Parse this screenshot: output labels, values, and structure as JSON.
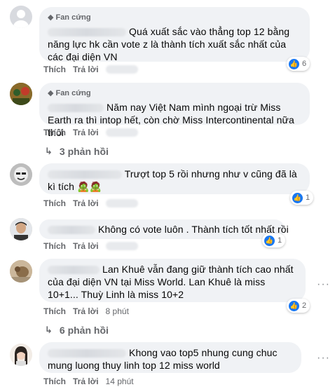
{
  "comments": [
    {
      "badge": "Fan cứng",
      "text": "Quá xuất sắc vào thẳng top 12 bằng năng lực hk cần vote z là thành tích xuất sắc nhất của các đại diện VN",
      "like": "Thích",
      "reply": "Trả lời",
      "reactions": "6"
    },
    {
      "badge": "Fan cứng",
      "text": "Năm nay Việt Nam mình ngoại trừ Miss Earth ra thì intop hết, còn chờ Miss Intercontinental nữa thôi",
      "like": "Thích",
      "reply": "Trả lời",
      "replies": "3 phản hồi"
    },
    {
      "text": "Trượt top 5 rồi nhưng như v cũng đã là kì tích 🧟🧟",
      "like": "Thích",
      "reply": "Trả lời",
      "reactions": "1"
    },
    {
      "text": "Không có vote luôn . Thành tích tốt nhất rồi",
      "like": "Thích",
      "reply": "Trả lời",
      "reactions": "1"
    },
    {
      "text": "Lan Khuê vẫn đang giữ thành tích cao nhất của đại diện VN tại Miss World. Lan Khuê là miss 10+1... Thuỳ Linh là miss 10+2",
      "like": "Thích",
      "reply": "Trả lời",
      "time": "8 phút",
      "reactions": "2",
      "replies": "6 phản hồi"
    },
    {
      "text": "Khong vao top5 nhung cung chuc mung luong thuy linh top 12 miss world",
      "like": "Thích",
      "reply": "Trả lời",
      "time": "14 phút"
    }
  ],
  "icons": {
    "badge": "diamond-icon",
    "reaction": "like-icon",
    "reply_arrow": "reply-arrow-icon",
    "more": "more-options-icon"
  },
  "colors": {
    "bubble": "#f0f2f5",
    "meta_text": "#65676b",
    "like_blue": "#1877f2"
  }
}
